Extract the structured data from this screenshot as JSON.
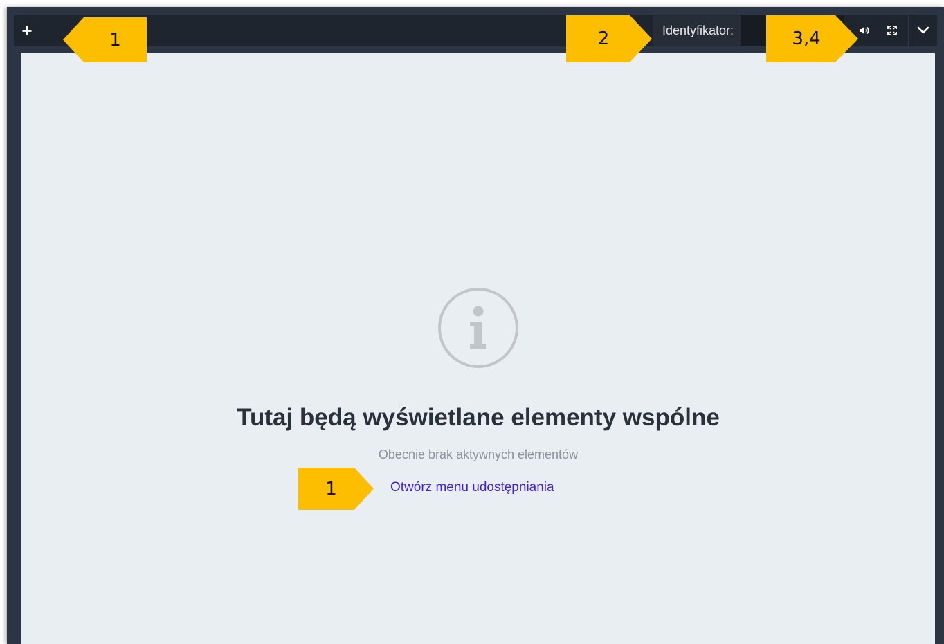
{
  "toolbar": {
    "add_label": "+",
    "id_label": "Identyfikator:",
    "icons": [
      "plus-icon",
      "speaker-icon",
      "fullscreen-icon",
      "chevron-down-icon"
    ]
  },
  "empty_state": {
    "icon": "info-icon",
    "title": "Tutaj będą wyświetlane elementy wspólne",
    "subtitle": "Obecnie brak aktywnych elementów",
    "link": "Otwórz menu udostępniania"
  },
  "annotations": {
    "marker_add": "1",
    "marker_id": "2",
    "marker_controls": "3,4",
    "marker_share": "1"
  },
  "colors": {
    "marker": "#fdbe00",
    "toolbar": "#1e252e",
    "frame": "#2c3543",
    "content": "#e9eef2",
    "link": "#3f1de0"
  }
}
